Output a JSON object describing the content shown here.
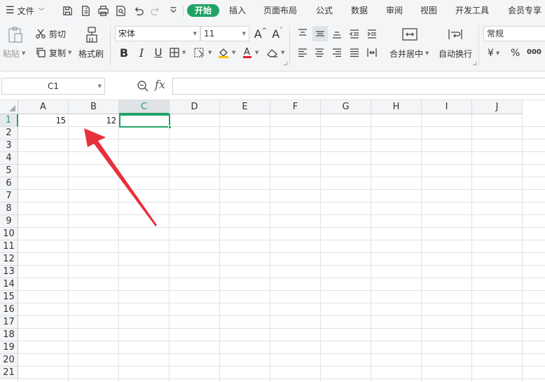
{
  "menubar": {
    "file_label": "文件",
    "tabs": [
      {
        "label": "开始",
        "active": true
      },
      {
        "label": "插入"
      },
      {
        "label": "页面布局"
      },
      {
        "label": "公式"
      },
      {
        "label": "数据"
      },
      {
        "label": "审阅"
      },
      {
        "label": "视图"
      },
      {
        "label": "开发工具"
      },
      {
        "label": "会员专享"
      }
    ]
  },
  "ribbon": {
    "paste_label": "粘贴",
    "cut_label": "剪切",
    "copy_label": "复制",
    "format_painter_label": "格式刷",
    "font_name": "宋体",
    "font_size": "11",
    "merge_center_label": "合并居中",
    "wrap_text_label": "自动换行",
    "number_format": "常规",
    "currency_symbol": "¥",
    "percent_symbol": "%",
    "thousands_symbol": "000"
  },
  "formula_bar": {
    "name_box": "C1",
    "fx_label": "fx",
    "formula": ""
  },
  "sheet": {
    "columns": [
      "A",
      "B",
      "C",
      "D",
      "E",
      "F",
      "G",
      "H",
      "I",
      "J"
    ],
    "rows": [
      "1",
      "2",
      "3",
      "4",
      "5",
      "6",
      "7",
      "8",
      "9",
      "10",
      "11",
      "12",
      "13",
      "14",
      "15",
      "16",
      "17",
      "18",
      "19",
      "20",
      "21"
    ],
    "selected_column": "C",
    "selected_row": "1",
    "cells": {
      "A1": "15",
      "B1": "12"
    }
  },
  "colors": {
    "accent": "#21a366",
    "annotation_arrow": "#e8303a"
  }
}
